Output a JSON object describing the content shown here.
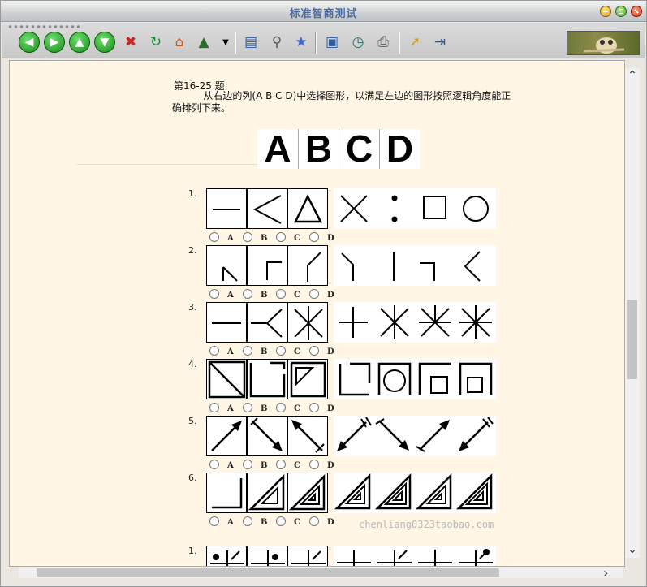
{
  "window": {
    "title": "标准智商测试"
  },
  "toolbar": {
    "buttons": [
      {
        "name": "back-button",
        "icon": "arrow-left-icon"
      },
      {
        "name": "forward-button",
        "icon": "arrow-right-icon"
      },
      {
        "name": "up-button",
        "icon": "arrow-up-icon"
      },
      {
        "name": "down-button",
        "icon": "arrow-down-icon"
      },
      {
        "name": "stop-button",
        "icon": "stop-icon"
      },
      {
        "name": "refresh-button",
        "icon": "refresh-icon"
      },
      {
        "name": "home-button",
        "icon": "home-icon"
      },
      {
        "name": "tree-button",
        "icon": "tree-icon"
      },
      {
        "name": "sidebar-button",
        "icon": "sidebar-icon"
      },
      {
        "name": "search-button",
        "icon": "search-icon"
      },
      {
        "name": "favorites-button",
        "icon": "star-icon"
      },
      {
        "name": "window-button",
        "icon": "window-icon"
      },
      {
        "name": "history-button",
        "icon": "history-icon"
      },
      {
        "name": "print-button",
        "icon": "printer-icon"
      },
      {
        "name": "cursor-button",
        "icon": "cursor-icon"
      },
      {
        "name": "exit-button",
        "icon": "exit-icon"
      }
    ]
  },
  "quiz": {
    "title": "第16-25 题:",
    "instruction": "从右边的列(A B C D)中选择图形，以满足左边的图形按照逻辑角度能正确排列下来。",
    "header_letters": [
      "A",
      "B",
      "C",
      "D"
    ],
    "option_labels": [
      "A",
      "B",
      "C",
      "D"
    ],
    "questions": [
      {
        "number": "1."
      },
      {
        "number": "2."
      },
      {
        "number": "3."
      },
      {
        "number": "4."
      },
      {
        "number": "5."
      },
      {
        "number": "6."
      },
      {
        "number": "1."
      }
    ]
  },
  "watermark": "chenliang0323taobao.com",
  "colors": {
    "page_background": "#fff6e6",
    "title_color": "#4a6aa0"
  }
}
